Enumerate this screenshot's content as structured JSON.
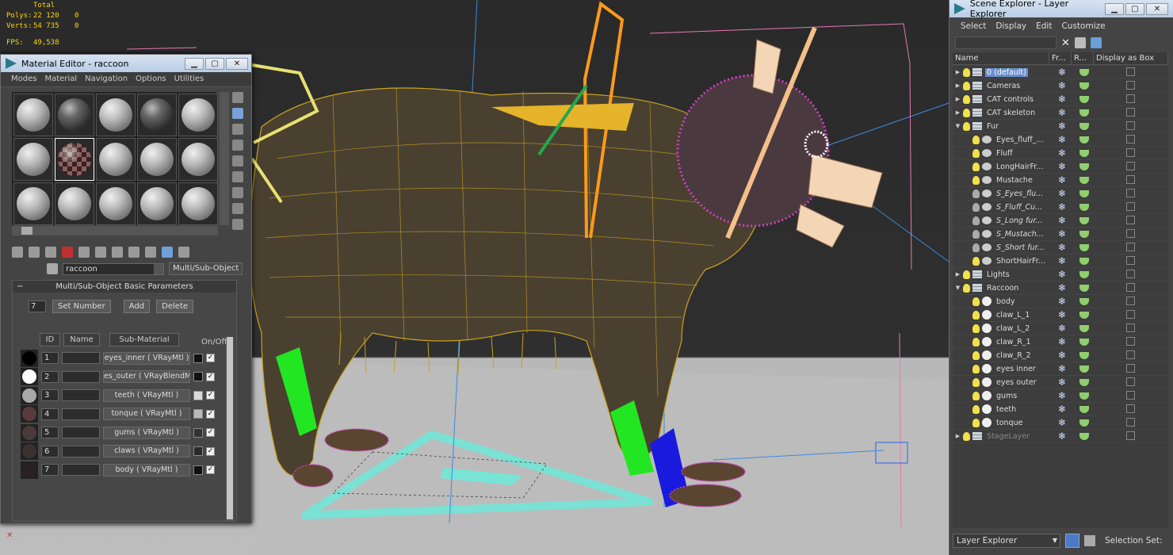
{
  "stats": {
    "total_label": "Total",
    "polys_label": "Polys:",
    "polys_total": "22 120",
    "polys_sel": "0",
    "verts_label": "Verts:",
    "verts_total": "54 735",
    "verts_sel": "0",
    "fps_label": "FPS:",
    "fps_value": "49,538"
  },
  "material_editor": {
    "title": "Material Editor - raccoon",
    "menu": [
      "Modes",
      "Material",
      "Navigation",
      "Options",
      "Utilities"
    ],
    "material_name": "raccoon",
    "material_type": "Multi/Sub-Object",
    "rollout_title": "Multi/Sub-Object Basic Parameters",
    "rollout_toggle": "−",
    "count": "7",
    "set_number_label": "Set Number",
    "add_label": "Add",
    "delete_label": "Delete",
    "col_id": "ID",
    "col_name": "Name",
    "col_sub": "Sub-Material",
    "col_onoff": "On/Off",
    "sub_materials": [
      {
        "id": "1",
        "material": "eyes_inner  ( VRayMtl )",
        "swatch": "#000000",
        "color": "#111111"
      },
      {
        "id": "2",
        "material": "es_outer  ( VRayBlendMtl )",
        "swatch": "#ffffff",
        "color": "#111111"
      },
      {
        "id": "3",
        "material": "teeth  ( VRayMtl )",
        "swatch": "#a8a8a8",
        "color": "#d8d8d8"
      },
      {
        "id": "4",
        "material": "tonque  ( VRayMtl )",
        "swatch": "#5a3a3e",
        "color": "#b9b9b9"
      },
      {
        "id": "5",
        "material": "gums  ( VRayMtl )",
        "swatch": "#4a3a3a",
        "color": "#333333"
      },
      {
        "id": "6",
        "material": "claws  ( VRayMtl )",
        "swatch": "#3a3030",
        "color": "#2a2a2a"
      },
      {
        "id": "7",
        "material": "body  ( VRayMtl )",
        "swatch": "#2a2222",
        "color": "#111111"
      }
    ],
    "check_mark": "✓"
  },
  "scene_explorer": {
    "title": "Scene Explorer - Layer Explorer",
    "menu": [
      "Select",
      "Display",
      "Edit",
      "Customize"
    ],
    "clear_icon": "✕",
    "columns": {
      "name": "Name",
      "freeze": "Fr...",
      "render": "R...",
      "box": "Display as Box"
    },
    "rows": [
      {
        "indent": 0,
        "tri": "▶",
        "kind": "layer",
        "name": "0 (default)",
        "selected": true
      },
      {
        "indent": 0,
        "tri": "▶",
        "kind": "layer",
        "name": "Cameras"
      },
      {
        "indent": 0,
        "tri": "▶",
        "kind": "layer",
        "name": "CAT controls"
      },
      {
        "indent": 0,
        "tri": "▶",
        "kind": "layer",
        "name": "CAT skeleton"
      },
      {
        "indent": 0,
        "tri": "▼",
        "kind": "layer",
        "name": "Fur"
      },
      {
        "indent": 1,
        "tri": "",
        "kind": "hair",
        "name": "Eyes_fluff_..."
      },
      {
        "indent": 1,
        "tri": "",
        "kind": "hair",
        "name": "Fluff"
      },
      {
        "indent": 1,
        "tri": "",
        "kind": "hair",
        "name": "LongHairFr..."
      },
      {
        "indent": 1,
        "tri": "",
        "kind": "hair",
        "name": "Mustache"
      },
      {
        "indent": 1,
        "tri": "",
        "kind": "hair",
        "name": "S_Eyes_flu...",
        "italic": true,
        "off": true
      },
      {
        "indent": 1,
        "tri": "",
        "kind": "hair",
        "name": "S_Fluff_Cu...",
        "italic": true,
        "off": true
      },
      {
        "indent": 1,
        "tri": "",
        "kind": "hair",
        "name": "S_Long fur...",
        "italic": true,
        "off": true
      },
      {
        "indent": 1,
        "tri": "",
        "kind": "hair",
        "name": "S_Mustach...",
        "italic": true,
        "off": true
      },
      {
        "indent": 1,
        "tri": "",
        "kind": "hair",
        "name": "S_Short fur...",
        "italic": true,
        "off": true
      },
      {
        "indent": 1,
        "tri": "",
        "kind": "hair",
        "name": "ShortHairFr..."
      },
      {
        "indent": 0,
        "tri": "▶",
        "kind": "layer",
        "name": "Lights"
      },
      {
        "indent": 0,
        "tri": "▼",
        "kind": "layer",
        "name": "Raccoon"
      },
      {
        "indent": 1,
        "tri": "",
        "kind": "obj",
        "name": "body"
      },
      {
        "indent": 1,
        "tri": "",
        "kind": "obj",
        "name": "claw_L_1"
      },
      {
        "indent": 1,
        "tri": "",
        "kind": "obj",
        "name": "claw_L_2"
      },
      {
        "indent": 1,
        "tri": "",
        "kind": "obj",
        "name": "claw_R_1"
      },
      {
        "indent": 1,
        "tri": "",
        "kind": "obj",
        "name": "claw_R_2"
      },
      {
        "indent": 1,
        "tri": "",
        "kind": "obj",
        "name": "eyes inner"
      },
      {
        "indent": 1,
        "tri": "",
        "kind": "obj",
        "name": "eyes outer"
      },
      {
        "indent": 1,
        "tri": "",
        "kind": "obj",
        "name": "gums"
      },
      {
        "indent": 1,
        "tri": "",
        "kind": "obj",
        "name": "teeth"
      },
      {
        "indent": 1,
        "tri": "",
        "kind": "obj",
        "name": "tonque"
      },
      {
        "indent": 0,
        "tri": "▶",
        "kind": "layer",
        "name": "StageLayer",
        "dim": true
      }
    ],
    "freeze_glyph": "❄",
    "explorer_type": "Layer Explorer",
    "dropdown_arrow": "▼",
    "selection_set_label": "Selection Set:"
  },
  "window_buttons": {
    "minimize": "▁",
    "maximize": "▢",
    "close": "✕"
  }
}
